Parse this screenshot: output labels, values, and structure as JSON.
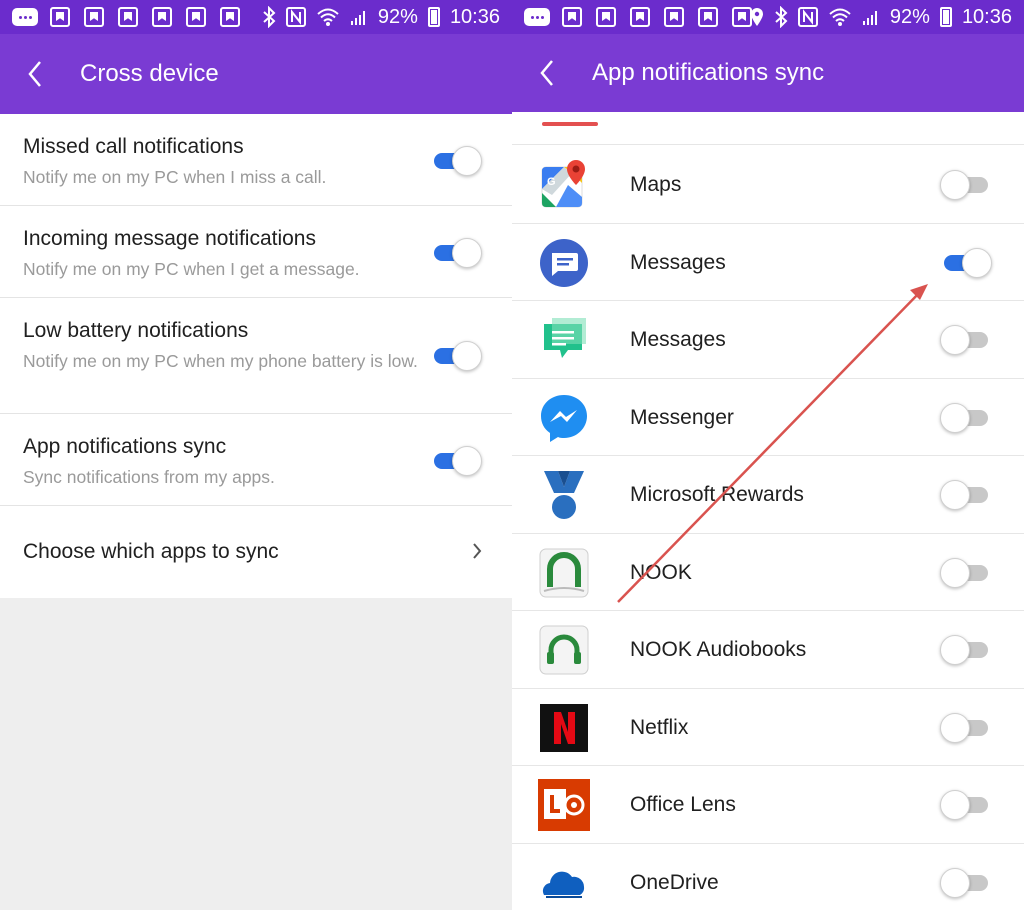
{
  "status_bar": {
    "battery_percent": "92%",
    "time": "10:36"
  },
  "left_screen": {
    "title": "Cross device",
    "settings": [
      {
        "title": "Missed call notifications",
        "subtitle": "Notify me on my PC when I miss a call.",
        "enabled": true
      },
      {
        "title": "Incoming message notifications",
        "subtitle": "Notify me on my PC when I get a message.",
        "enabled": true
      },
      {
        "title": "Low battery notifications",
        "subtitle": "Notify me on my PC when my phone battery is low.",
        "enabled": true
      },
      {
        "title": "App notifications sync",
        "subtitle": "Sync notifications from my apps.",
        "enabled": true
      }
    ],
    "choose_apps_label": "Choose which apps to sync"
  },
  "right_screen": {
    "title": "App notifications sync",
    "apps": [
      {
        "name": "Maps",
        "icon": "google-maps-icon",
        "enabled": false
      },
      {
        "name": "Messages",
        "icon": "android-messages-icon",
        "enabled": true
      },
      {
        "name": "Messages",
        "icon": "samsung-messages-icon",
        "enabled": false
      },
      {
        "name": "Messenger",
        "icon": "facebook-messenger-icon",
        "enabled": false
      },
      {
        "name": "Microsoft Rewards",
        "icon": "microsoft-rewards-medal-icon",
        "enabled": false
      },
      {
        "name": "NOOK",
        "icon": "nook-icon",
        "enabled": false
      },
      {
        "name": "NOOK Audiobooks",
        "icon": "nook-audiobooks-icon",
        "enabled": false
      },
      {
        "name": "Netflix",
        "icon": "netflix-icon",
        "enabled": false
      },
      {
        "name": "Office Lens",
        "icon": "office-lens-icon",
        "enabled": false
      },
      {
        "name": "OneDrive",
        "icon": "onedrive-icon",
        "enabled": false
      }
    ]
  },
  "colors": {
    "status_bar": "#6b2ccc",
    "app_bar": "#7a3bd3",
    "toggle_on": "#2b70e3",
    "annotation_arrow": "#d9534f"
  }
}
